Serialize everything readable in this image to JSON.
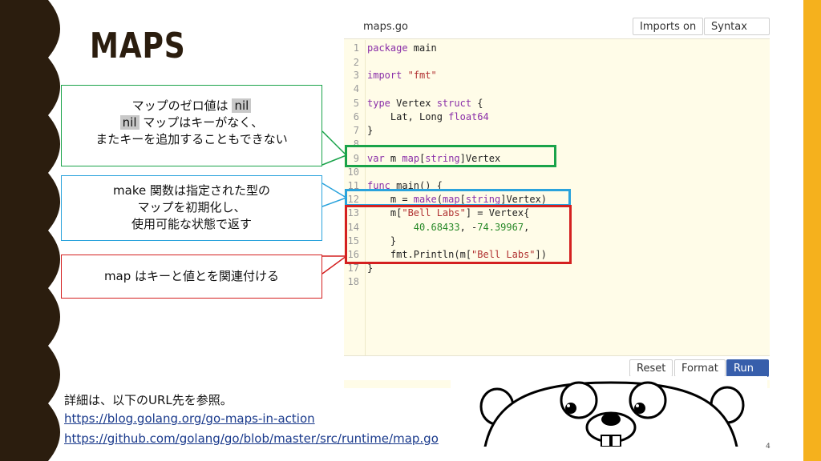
{
  "slide": {
    "title": "MAPS",
    "page_number": "4"
  },
  "playground": {
    "filename": "maps.go",
    "imports_label": "Imports on",
    "syntax_label": "Syntax on",
    "reset_label": "Reset",
    "format_label": "Format",
    "run_label": "Run",
    "line_numbers": [
      "1",
      "2",
      "3",
      "4",
      "5",
      "6",
      "7",
      "8",
      "9",
      "10",
      "11",
      "12",
      "13",
      "14",
      "15",
      "16",
      "17",
      "18"
    ]
  },
  "callouts": {
    "zero_line1": "マップのゼロ値は",
    "zero_nil1": "nil",
    "zero_nil2": "nil",
    "zero_line2": "マップはキーがなく、",
    "zero_line3": "またキーを追加することもできない",
    "make_line1": "make 関数は指定された型の",
    "make_line2": "マップを初期化し、",
    "make_line3": "使用可能な状態で返す",
    "map_line1": "map はキーと値とを関連付ける"
  },
  "references": {
    "intro": "詳細は、以下のURL先を参照。",
    "link1": "https://blog.golang.org/go-maps-in-action",
    "link2": "https://github.com/golang/go/blob/master/src/runtime/map.go"
  },
  "colors": {
    "green": "#1aa34a",
    "blue": "#2aa3dc",
    "red": "#d42020"
  }
}
